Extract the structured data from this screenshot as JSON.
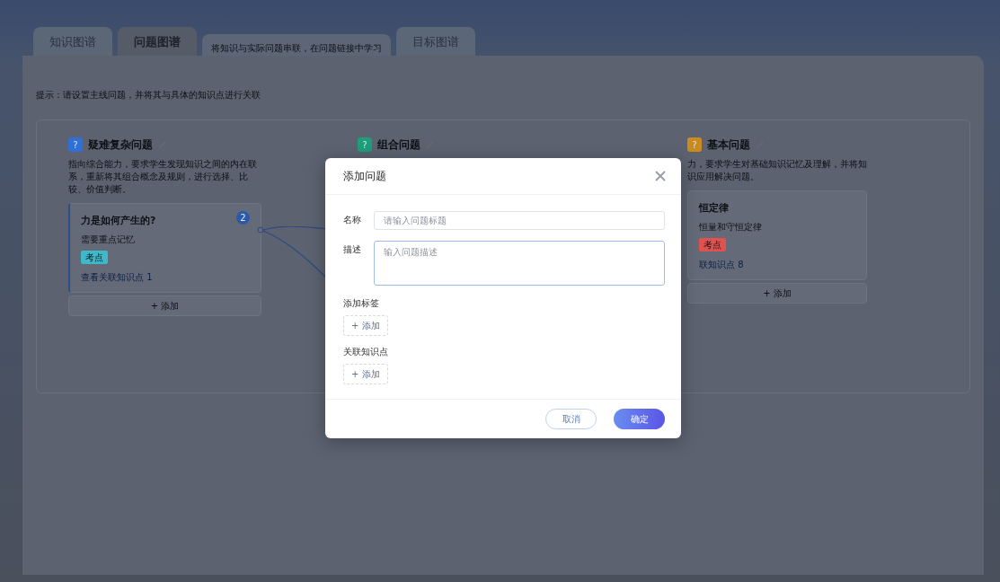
{
  "tabs": [
    {
      "label": "知识图谱",
      "selected": false
    },
    {
      "label": "问题图谱",
      "selected": true
    },
    {
      "label": "目标图谱",
      "selected": false
    }
  ],
  "tab_note": "将知识与实际问题串联，在问题链接中学习",
  "hint": "提示：请设置主线问题，并将其与具体的知识点进行关联",
  "columns": [
    {
      "icon": "?",
      "title": "疑难复杂问题",
      "color": "#2f6fd6",
      "description": "指向综合能力，要求学生发现知识之间的内在联系，重新将其组合概念及规则，进行选择、比较、价值判断。",
      "cards": [
        {
          "title": "力是如何产生的?",
          "description": "需要重点记忆",
          "tag": "考点",
          "color": "#3fb8c9",
          "link": "查看关联知识点",
          "count": "1",
          "badge": "2"
        }
      ],
      "add_label": "+ 添加"
    },
    {
      "icon": "?",
      "title": "组合问题",
      "color": "#1e9e7a"
    },
    {
      "icon": "?",
      "title": "基本问题",
      "color": "#c98a1e",
      "description": "力，要求学生对基础知识记忆及理解，并将知识应用解决问题。",
      "cards": [
        {
          "title": "恒定律",
          "description": "恒量和守恒定律",
          "tag": "考点",
          "color": "#e0524f",
          "link": "联知识点",
          "count": "8"
        }
      ],
      "add_label": "+ 添加"
    }
  ],
  "modal": {
    "title": "添加问题",
    "fields": [
      {
        "label": "名称",
        "placeholder": "请输入问题标题",
        "kind": "input",
        "focused": false
      },
      {
        "label": "描述",
        "placeholder": "输入问题描述",
        "kind": "textarea",
        "focused": true
      }
    ],
    "sections": [
      {
        "label": "添加标签",
        "add_label": "+ 添加"
      },
      {
        "label": "关联知识点",
        "add_label": "+ 添加"
      }
    ],
    "buttons": [
      {
        "label": "取消",
        "kind": "secondary"
      },
      {
        "label": "确定",
        "kind": "primary"
      }
    ]
  }
}
